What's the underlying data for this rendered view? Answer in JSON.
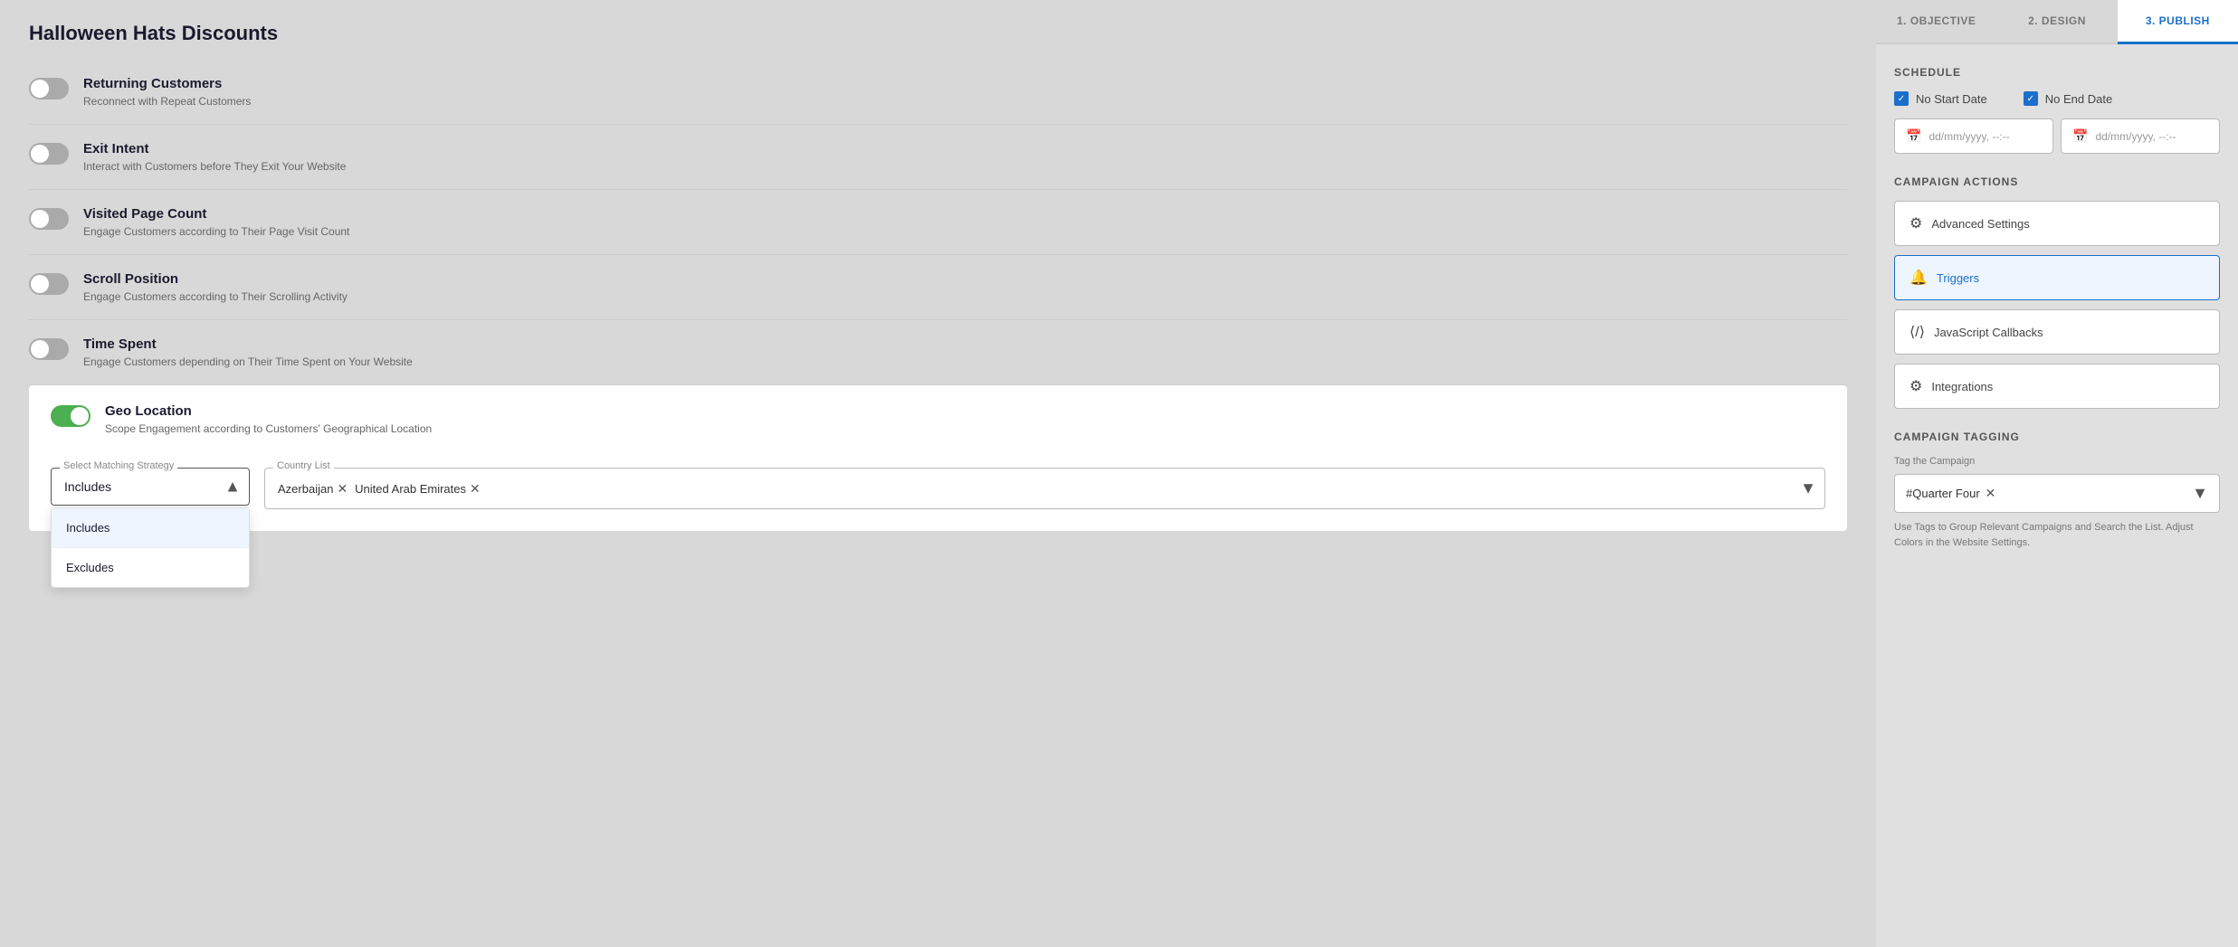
{
  "page": {
    "title": "Halloween Hats Discounts"
  },
  "left_panel": {
    "items": [
      {
        "id": "returning-customers",
        "title": "Returning Customers",
        "desc": "Reconnect with Repeat Customers",
        "active": false
      },
      {
        "id": "exit-intent",
        "title": "Exit Intent",
        "desc": "Interact with Customers before They Exit Your Website",
        "active": false
      },
      {
        "id": "visited-page-count",
        "title": "Visited Page Count",
        "desc": "Engage Customers according to Their Page Visit Count",
        "active": false
      },
      {
        "id": "scroll-position",
        "title": "Scroll Position",
        "desc": "Engage Customers according to Their Scrolling Activity",
        "active": false
      },
      {
        "id": "time-spent",
        "title": "Time Spent",
        "desc": "Engage Customers depending on Their Time Spent on Your Website",
        "active": false
      }
    ],
    "geo_location": {
      "title": "Geo Location",
      "desc": "Scope Engagement according to Customers' Geographical Location",
      "active": true,
      "select_label": "Select Matching Strategy",
      "selected_strategy": "Includes",
      "dropdown_options": [
        "Includes",
        "Excludes"
      ],
      "country_list_label": "Country List",
      "countries": [
        "Azerbaijan",
        "United Arab Emirates"
      ]
    }
  },
  "right_panel": {
    "tabs": [
      {
        "id": "objective",
        "label": "1. OBJECTIVE"
      },
      {
        "id": "design",
        "label": "2. DESIGN"
      },
      {
        "id": "publish",
        "label": "3. PUBLISH"
      }
    ],
    "active_tab": "publish",
    "schedule": {
      "section_title": "SCHEDULE",
      "no_start_label": "No Start Date",
      "no_end_label": "No End Date",
      "start_placeholder": "dd/mm/yyyy, --:--",
      "end_placeholder": "dd/mm/yyyy, --:--"
    },
    "campaign_actions": {
      "section_title": "CAMPAIGN ACTIONS",
      "buttons": [
        {
          "id": "advanced-settings",
          "label": "Advanced Settings",
          "icon": "⚙",
          "highlighted": false
        },
        {
          "id": "triggers",
          "label": "Triggers",
          "icon": "🔔",
          "highlighted": true
        },
        {
          "id": "javascript-callbacks",
          "label": "JavaScript Callbacks",
          "icon": "⟨⟩",
          "highlighted": false
        },
        {
          "id": "integrations",
          "label": "Integrations",
          "icon": "⚙",
          "highlighted": false
        }
      ]
    },
    "campaign_tagging": {
      "section_title": "CAMPAIGN TAGGING",
      "tag_label": "Tag the Campaign",
      "tag": "#Quarter Four",
      "hint": "Use Tags to Group Relevant Campaigns and Search the List. Adjust Colors in the Website Settings."
    }
  }
}
